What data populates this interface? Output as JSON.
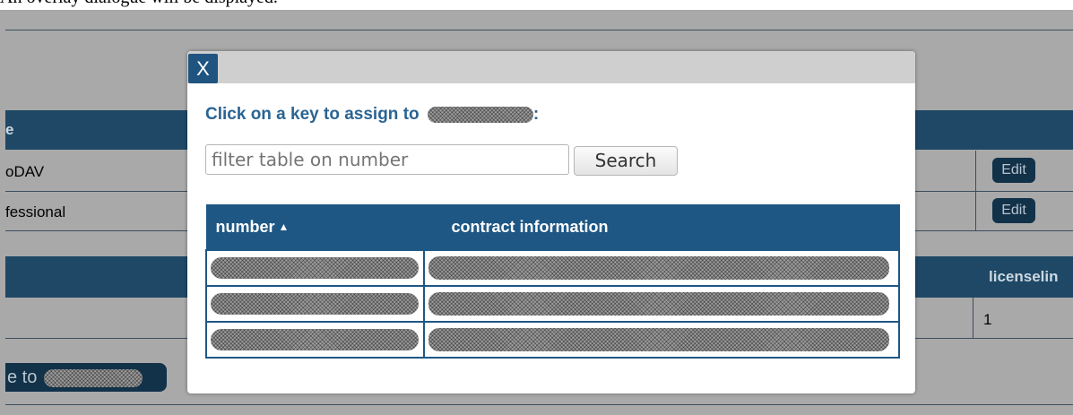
{
  "caption": "An overlay dialogue will be displayed.",
  "background": {
    "header1_partial": "e",
    "rows": [
      {
        "label": "oDAV",
        "action": "Edit"
      },
      {
        "label": "fessional",
        "action": "Edit"
      }
    ],
    "header2_partial": "licenselin",
    "row2_value": "1",
    "assign_button_partial": "e to"
  },
  "dialog": {
    "close_label": "X",
    "heading": "Click on a key to assign to",
    "heading_suffix": ":",
    "filter_placeholder": "filter table on number",
    "search_label": "Search",
    "columns": [
      "number",
      "contract information"
    ],
    "row_count": 3
  },
  "colors": {
    "accent_dark": "#12324a",
    "header_blue": "#1e5784",
    "heading_blue": "#2a6493"
  }
}
